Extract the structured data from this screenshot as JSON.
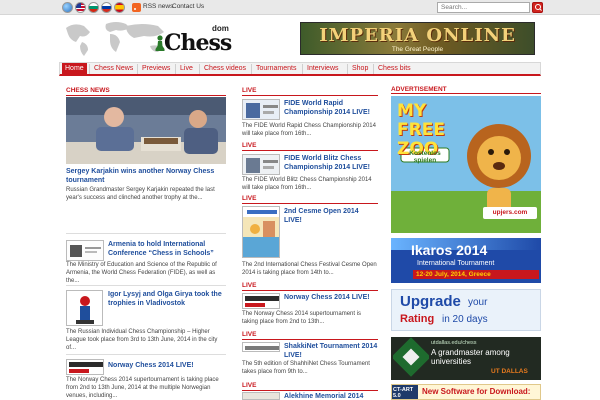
{
  "topbar": {
    "flags": [
      "globe-icon",
      "us-flag-icon",
      "bulgaria-flag-icon",
      "russia-flag-icon",
      "spain-flag-icon"
    ],
    "rss_label": "RSS news",
    "contact_label": "Contact Us",
    "search_placeholder": "Search..."
  },
  "header": {
    "logo_dom": "dom",
    "logo_chess": "Chess",
    "banner_title": "IMPERIA ONLINE",
    "banner_sub": "The Great People"
  },
  "nav": {
    "items": [
      "Home",
      "Chess News",
      "Previews",
      "Live",
      "Chess videos",
      "Tournaments",
      "Interviews",
      "Shop",
      "Chess bits"
    ]
  },
  "left": {
    "heading": "CHESS NEWS",
    "feature_title": "Sergey Karjakin wins another Norway Chess tournament",
    "feature_text": "Russian Grandmaster Sergey Karjakin repeated the last year's success and clinched another trophy at the...",
    "items": [
      {
        "title": "Armenia to hold International Conference “Chess in Schools”",
        "text": "The Ministry of Education and Science of the Republic of Armenia, the World Chess Federation (FIDE), as well as the..."
      },
      {
        "title": "Igor Lysyj and Olga Girya took the trophies in Vladivostok",
        "text": "The Russian Individual Chess Championship – Higher League took place from 3rd to 13th June, 2014 in the city of..."
      },
      {
        "title": "Norway Chess 2014 LIVE!",
        "text": "The Norway Chess 2014 supertournament is taking place from 2nd to 13th June, 2014 at the multiple Norwegian venues, including..."
      }
    ]
  },
  "live": {
    "heading": "LIVE",
    "items": [
      {
        "label": "LIVE",
        "title": "FIDE World Rapid Championship 2014 LIVE!",
        "text": "The FIDE World Rapid Chess Championship 2014 will take place from 16th..."
      },
      {
        "label": "LIVE",
        "title": "FIDE World Blitz Chess Championship 2014 LIVE!",
        "text": "The FIDE World Blitz Chess Championship 2014 will take place from 16th..."
      },
      {
        "label": "LIVE",
        "title": "2nd Cesme Open 2014 LIVE!",
        "text": "The 2nd International Chess Festival Cesme Open 2014 is taking place from 14th to..."
      },
      {
        "label": "LIVE",
        "title": "Norway Chess 2014 LIVE!",
        "text": "The Norway Chess 2014 supertournament is taking place from 2nd to 13th..."
      },
      {
        "label": "LIVE",
        "title": "ShakkiNet Tournament 2014 LIVE!",
        "text": "The 5th edition of ShahhiNet Chess Tournament takes place from 9th to..."
      },
      {
        "label": "LIVE",
        "title": "Alekhine Memorial 2014",
        "text": ""
      }
    ]
  },
  "ads": {
    "heading": "ADVERTISEMENT",
    "zoo_title": "MY FREE ZOO",
    "zoo_button": "Kostenlos spielen",
    "zoo_brand": "upjers.com",
    "ikaros_title": "Ikaros 2014",
    "ikaros_sub": "International Tournament",
    "ikaros_dates": "12-20 July, 2014, Greece",
    "upgrade_line1": "Upgrade",
    "upgrade_line2": "your",
    "upgrade_line3": "Rating",
    "upgrade_line4": "in 20 days",
    "utd_url": "utdallas.edu/chess",
    "utd_text": "A grandmaster among universities",
    "utd_brand": "UT DALLAS",
    "ctart_label": "CT-ART 5.0",
    "ctart_text": "New Software for Download:"
  }
}
